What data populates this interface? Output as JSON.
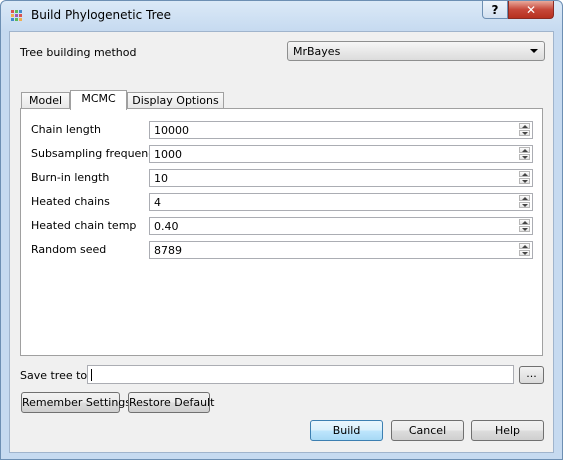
{
  "window": {
    "title": "Build Phylogenetic Tree",
    "help_label": "?",
    "close_label": "✕"
  },
  "method": {
    "label": "Tree building method",
    "value": "MrBayes"
  },
  "tabs": [
    {
      "label": "Model"
    },
    {
      "label": "MCMC"
    },
    {
      "label": "Display Options"
    }
  ],
  "mcmc": {
    "fields": [
      {
        "label": "Chain length",
        "value": "10000"
      },
      {
        "label": "Subsampling frequence",
        "value": "1000"
      },
      {
        "label": "Burn-in length",
        "value": "10"
      },
      {
        "label": "Heated chains",
        "value": "4"
      },
      {
        "label": "Heated chain temp",
        "value": "0.40"
      },
      {
        "label": "Random seed",
        "value": "8789"
      }
    ]
  },
  "save": {
    "label": "Save tree to",
    "value": "",
    "browse_label": "..."
  },
  "buttons": {
    "remember": "Remember Settings",
    "restore": "Restore Default",
    "build": "Build",
    "cancel": "Cancel",
    "help": "Help"
  },
  "icons": {
    "app": "tree-app-icon",
    "spin_up": "arrow-up-icon",
    "spin_down": "arrow-down-icon"
  }
}
